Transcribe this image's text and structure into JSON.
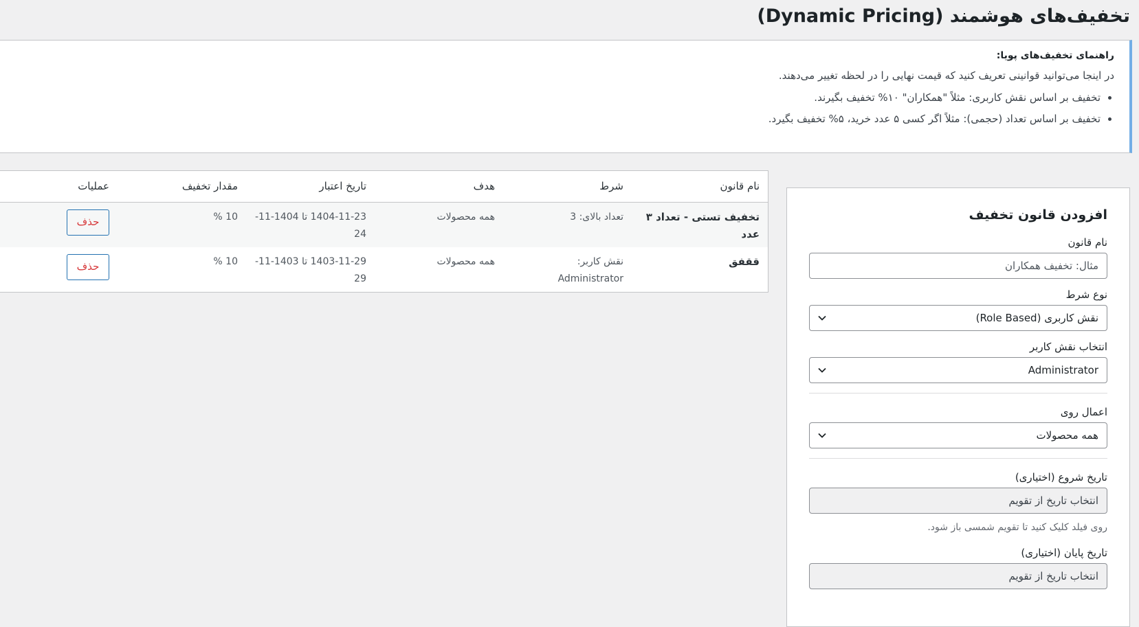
{
  "page": {
    "title": "تخفیف‌های هوشمند (Dynamic Pricing)"
  },
  "notice": {
    "title": "راهنمای تخفیف‌های پویا:",
    "description": "در اینجا می‌توانید قوانینی تعریف کنید که قیمت نهایی را در لحظه تغییر می‌دهند.",
    "items": [
      "تخفیف بر اساس نقش کاربری: مثلاً \"همکاران\" ۱۰% تخفیف بگیرند.",
      "تخفیف بر اساس تعداد (حجمی): مثلاً اگر کسی ۵ عدد خرید، ۵% تخفیف بگیرد."
    ]
  },
  "rules_table": {
    "headers": [
      "نام قانون",
      "شرط",
      "هدف",
      "تاریخ اعتبار",
      "مقدار تخفیف",
      "عملیات"
    ],
    "rows": [
      {
        "name": "تخفیف تستی - تعداد ۳ عدد",
        "condition": "تعداد بالای: 3",
        "target": "همه محصولات",
        "validity": "1404-11-23 تا 1404-11-24",
        "amount": "10 %",
        "action_label": "حذف"
      },
      {
        "name": "ققفق",
        "condition": "نقش کاربر: Administrator",
        "target": "همه محصولات",
        "validity": "1403-11-29 تا 1403-11-29",
        "amount": "10 %",
        "action_label": "حذف"
      }
    ]
  },
  "add_rule": {
    "title": "افزودن قانون تخفیف",
    "rule_name": {
      "label": "نام قانون",
      "placeholder": "مثال: تخفیف همکاران",
      "value": ""
    },
    "condition_type": {
      "label": "نوع شرط",
      "selected": "نقش کاربری (Role Based)"
    },
    "user_role": {
      "label": "انتخاب نقش کاربر",
      "selected": "Administrator"
    },
    "apply_on": {
      "label": "اعمال روی",
      "selected": "همه محصولات"
    },
    "start_date": {
      "label": "تاریخ شروع (اختیاری)",
      "placeholder": "انتخاب تاریخ از تقویم",
      "help": "روی فیلد کلیک کنید تا تقویم شمسی باز شود."
    },
    "end_date": {
      "label": "تاریخ پایان (اختیاری)",
      "placeholder": "انتخاب تاریخ از تقویم"
    }
  },
  "icons": {
    "select_chevron": "chevron-down-icon"
  }
}
